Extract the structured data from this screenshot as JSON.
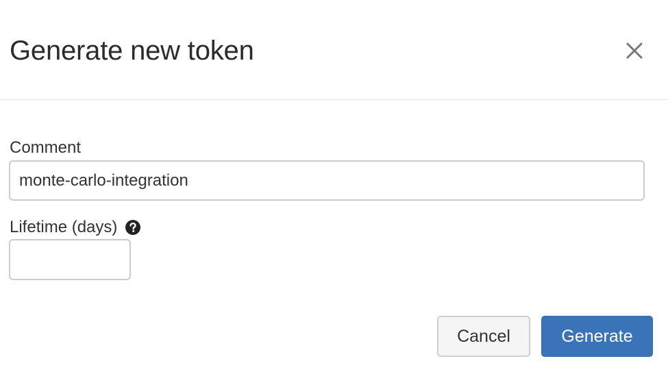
{
  "dialog": {
    "title": "Generate new token",
    "close_icon": "close-icon"
  },
  "form": {
    "comment": {
      "label": "Comment",
      "value": "monte-carlo-integration",
      "placeholder": ""
    },
    "lifetime": {
      "label": "Lifetime (days)",
      "value": "",
      "placeholder": "",
      "help_icon": "question-circle-icon"
    }
  },
  "actions": {
    "cancel_label": "Cancel",
    "generate_label": "Generate"
  },
  "colors": {
    "primary": "#3b73b9",
    "border": "#cccccc",
    "title": "#2b2b2b"
  }
}
